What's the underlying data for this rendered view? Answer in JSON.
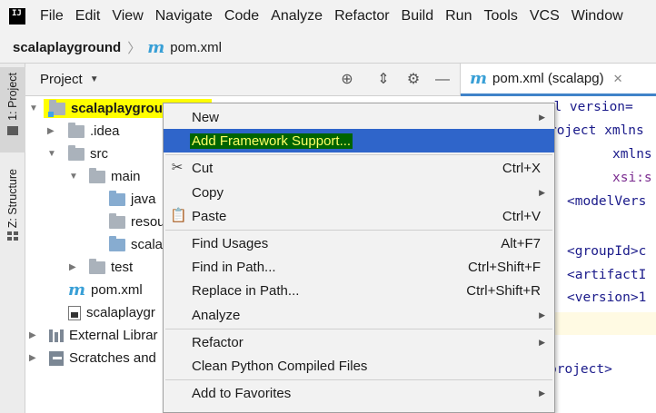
{
  "menubar": {
    "items": [
      "File",
      "Edit",
      "View",
      "Navigate",
      "Code",
      "Analyze",
      "Refactor",
      "Build",
      "Run",
      "Tools",
      "VCS",
      "Window"
    ]
  },
  "breadcrumb": {
    "project": "scalaplayground",
    "file": "pom.xml"
  },
  "left_strip": {
    "project_tab": "1: Project",
    "structure_tab": "Z: Structure"
  },
  "project_panel": {
    "title": "Project",
    "tree": [
      {
        "label": "scalaplaygrou",
        "icon": "module-folder-icon",
        "expanded": true
      },
      {
        "label": ".idea",
        "icon": "folder-icon"
      },
      {
        "label": "src",
        "icon": "folder-icon"
      },
      {
        "label": "main",
        "icon": "folder-icon"
      },
      {
        "label": "java",
        "icon": "source-folder-icon"
      },
      {
        "label": "resou",
        "icon": "resources-folder-icon"
      },
      {
        "label": "scala",
        "icon": "source-folder-icon"
      },
      {
        "label": "test",
        "icon": "folder-icon"
      },
      {
        "label": "pom.xml",
        "icon": "maven-icon"
      },
      {
        "label": "scalaplaygr",
        "icon": "iml-file-icon"
      },
      {
        "label": "External Librar",
        "icon": "library-icon"
      },
      {
        "label": "Scratches and",
        "icon": "scratches-icon"
      }
    ]
  },
  "editor": {
    "tab_label": "pom.xml (scalapg)",
    "lines": [
      "xml version=",
      "roject xmlns",
      "xmlns",
      "xsi:s",
      "<modelVers",
      "<groupId>c",
      "<artifactI",
      "<version>1",
      "project>"
    ]
  },
  "context_menu": {
    "items": [
      {
        "label": "New",
        "shortcut": "",
        "submenu": true
      },
      {
        "label": "Add Framework Support...",
        "shortcut": "",
        "submenu": false,
        "selected": true
      },
      {
        "label": "Cut",
        "shortcut": "Ctrl+X",
        "icon": "scissors-icon"
      },
      {
        "label": "Copy",
        "shortcut": "",
        "submenu": true
      },
      {
        "label": "Paste",
        "shortcut": "Ctrl+V",
        "icon": "clipboard-icon"
      },
      {
        "label": "Find Usages",
        "shortcut": "Alt+F7"
      },
      {
        "label": "Find in Path...",
        "shortcut": "Ctrl+Shift+F"
      },
      {
        "label": "Replace in Path...",
        "shortcut": "Ctrl+Shift+R"
      },
      {
        "label": "Analyze",
        "shortcut": "",
        "submenu": true
      },
      {
        "label": "Refactor",
        "shortcut": "",
        "submenu": true
      },
      {
        "label": "Clean Python Compiled Files",
        "shortcut": ""
      },
      {
        "label": "Add to Favorites",
        "shortcut": "",
        "submenu": true
      }
    ]
  },
  "colors": {
    "selection_blue": "#2f65ca",
    "highlight_yellow": "#ffff00",
    "label_highlight_green": "#006400"
  }
}
